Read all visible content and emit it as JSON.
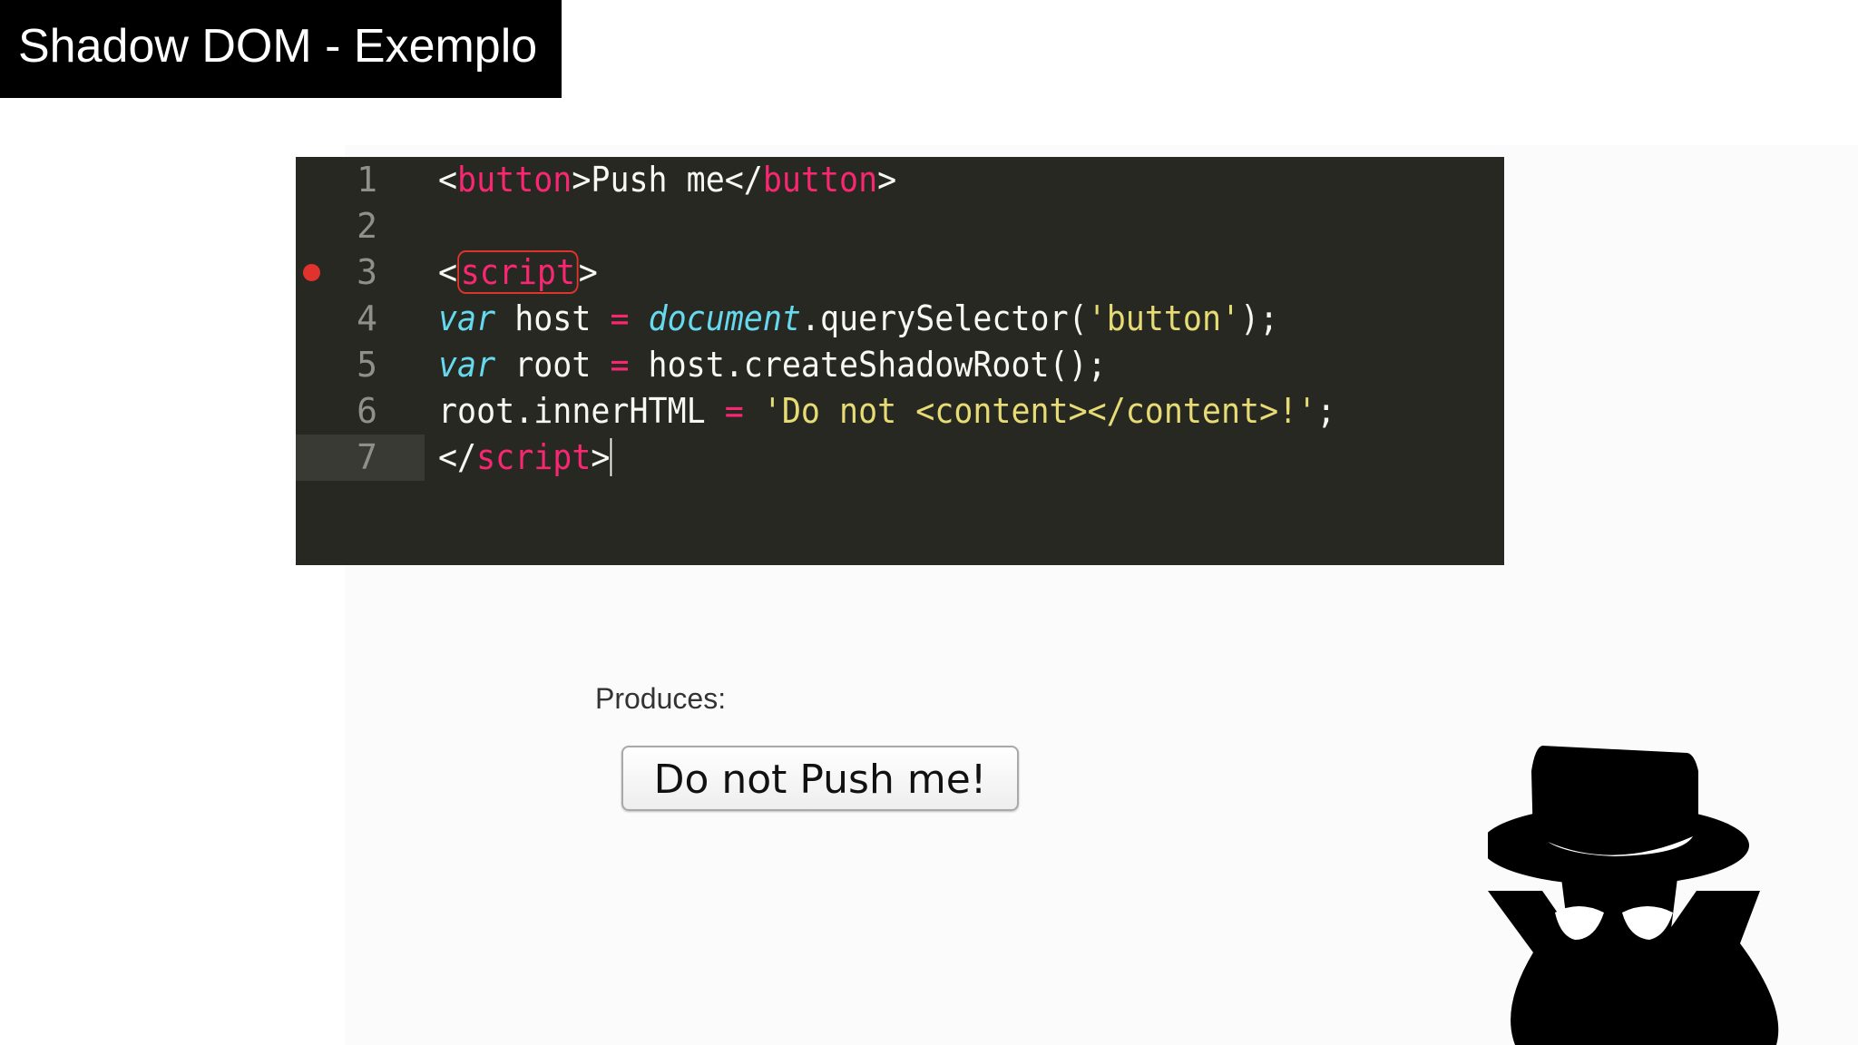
{
  "slide": {
    "title": "Shadow DOM - Exemplo"
  },
  "editor": {
    "current_line": 7,
    "breakpoint_line": 3,
    "lines": [
      {
        "number": "1",
        "tokens": [
          {
            "t": "<",
            "c": "plain"
          },
          {
            "t": "button",
            "c": "tag"
          },
          {
            "t": ">Push me</",
            "c": "plain"
          },
          {
            "t": "button",
            "c": "tag"
          },
          {
            "t": ">",
            "c": "plain"
          }
        ]
      },
      {
        "number": "2",
        "tokens": []
      },
      {
        "number": "3",
        "tokens": [
          {
            "t": "<",
            "c": "plain"
          },
          {
            "t": "script",
            "c": "tag-boxed"
          },
          {
            "t": ">",
            "c": "plain"
          }
        ]
      },
      {
        "number": "4",
        "tokens": [
          {
            "t": "var",
            "c": "kw"
          },
          {
            "t": " host ",
            "c": "plain"
          },
          {
            "t": "=",
            "c": "op"
          },
          {
            "t": " ",
            "c": "plain"
          },
          {
            "t": "document",
            "c": "kw"
          },
          {
            "t": ".querySelector(",
            "c": "plain"
          },
          {
            "t": "'button'",
            "c": "str"
          },
          {
            "t": ");",
            "c": "plain"
          }
        ]
      },
      {
        "number": "5",
        "tokens": [
          {
            "t": "var",
            "c": "kw"
          },
          {
            "t": " root ",
            "c": "plain"
          },
          {
            "t": "=",
            "c": "op"
          },
          {
            "t": " host.createShadowRoot();",
            "c": "plain"
          }
        ]
      },
      {
        "number": "6",
        "tokens": [
          {
            "t": "root.innerHTML ",
            "c": "plain"
          },
          {
            "t": "=",
            "c": "op"
          },
          {
            "t": " ",
            "c": "plain"
          },
          {
            "t": "'Do not <content></content>!'",
            "c": "str"
          },
          {
            "t": ";",
            "c": "plain"
          }
        ]
      },
      {
        "number": "7",
        "tokens": [
          {
            "t": "</",
            "c": "plain"
          },
          {
            "t": "script",
            "c": "tag"
          },
          {
            "t": ">",
            "c": "plain"
          }
        ],
        "caret": true
      }
    ]
  },
  "output": {
    "label": "Produces:",
    "button_label": "Do not Push me!"
  },
  "icons": {
    "spy": "incognito-spy-icon"
  },
  "colors": {
    "editor_background": "#272822",
    "tag": "#f92672",
    "keyword": "#66d9ef",
    "string": "#e6db74",
    "breakpoint": "#e0332d"
  }
}
